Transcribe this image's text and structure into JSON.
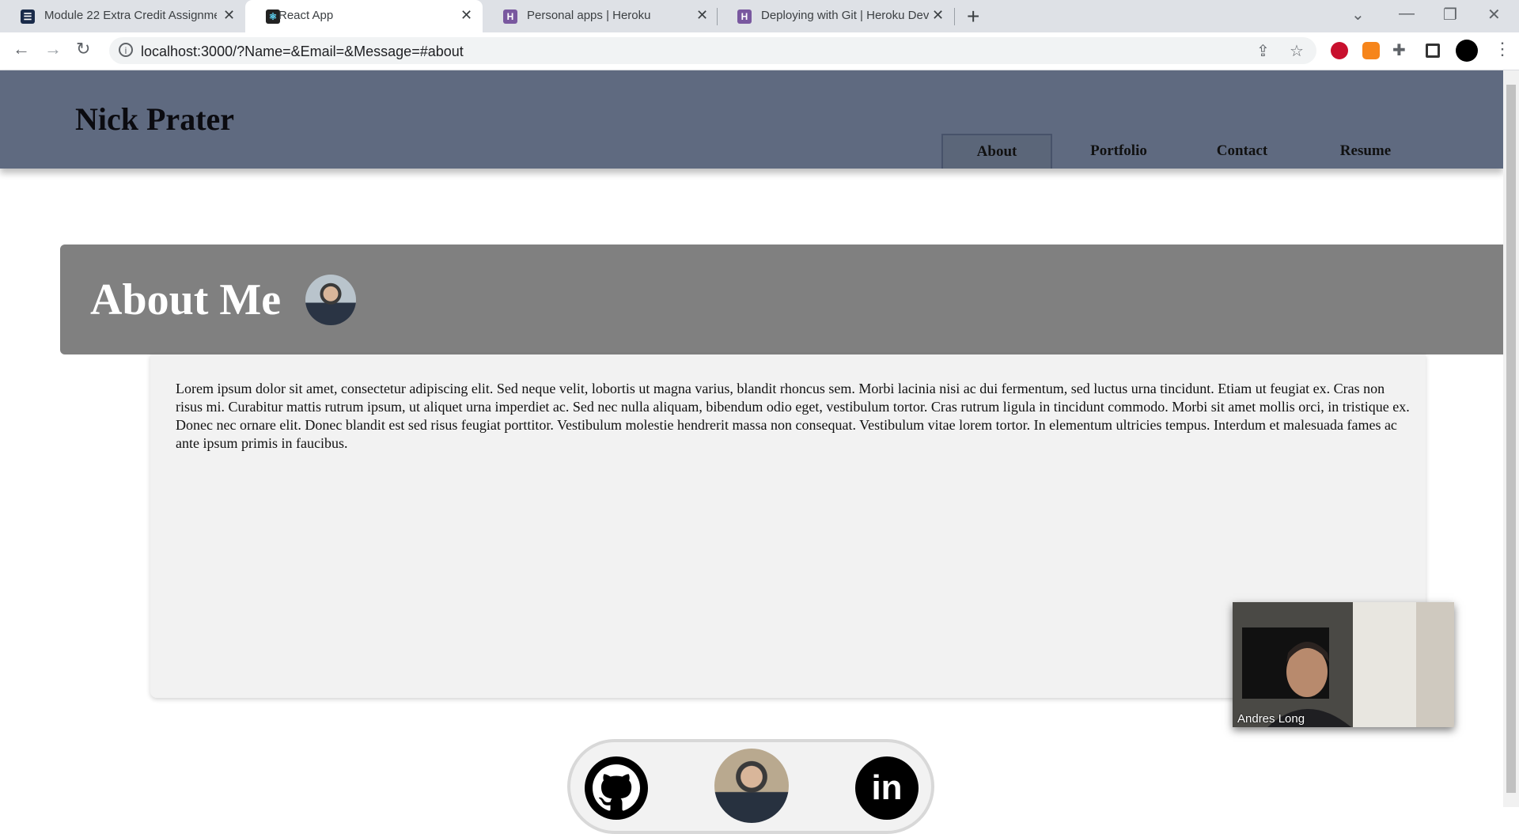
{
  "browser": {
    "tabs": [
      {
        "title": "Module 22 Extra Credit Assignme",
        "favicon": "module-favicon",
        "active": false
      },
      {
        "title": "React App",
        "favicon": "react-icon",
        "active": true
      },
      {
        "title": "Personal apps | Heroku",
        "favicon": "heroku-icon",
        "active": false
      },
      {
        "title": "Deploying with Git | Heroku Dev",
        "favicon": "heroku-icon",
        "active": false
      }
    ],
    "url": "localhost:3000/?Name=&Email=&Message=#about"
  },
  "site": {
    "name": "Nick Prater",
    "nav": [
      {
        "label": "About",
        "active": true
      },
      {
        "label": "Portfolio",
        "active": false
      },
      {
        "label": "Contact",
        "active": false
      },
      {
        "label": "Resume",
        "active": false
      }
    ]
  },
  "about": {
    "title": "About Me",
    "body": "Lorem ipsum dolor sit amet, consectetur adipiscing elit. Sed neque velit, lobortis ut magna varius, blandit rhoncus sem. Morbi lacinia nisi ac dui fermentum, sed luctus urna tincidunt. Etiam ut feugiat ex. Cras non risus mi. Curabitur mattis rutrum ipsum, ut aliquet urna imperdiet ac. Sed nec nulla aliquam, bibendum odio eget, vestibulum tortor. Cras rutrum ligula in tincidunt commodo. Morbi sit amet mollis orci, in tristique ex. Donec nec ornare elit. Donec blandit est sed risus feugiat porttitor. Vestibulum molestie hendrerit massa non consequat. Vestibulum vitae lorem tortor. In elementum ultricies tempus. Interdum et malesuada fames ac ante ipsum primis in faucibus."
  },
  "video": {
    "participant": "Andres Long"
  },
  "footer": {
    "icons": [
      "github-icon",
      "avatar",
      "linkedin-icon"
    ],
    "linkedin_text": "in"
  },
  "colors": {
    "header_bg": "#5f6a80",
    "banner_bg": "#808080",
    "card_bg": "#f2f2f2"
  }
}
